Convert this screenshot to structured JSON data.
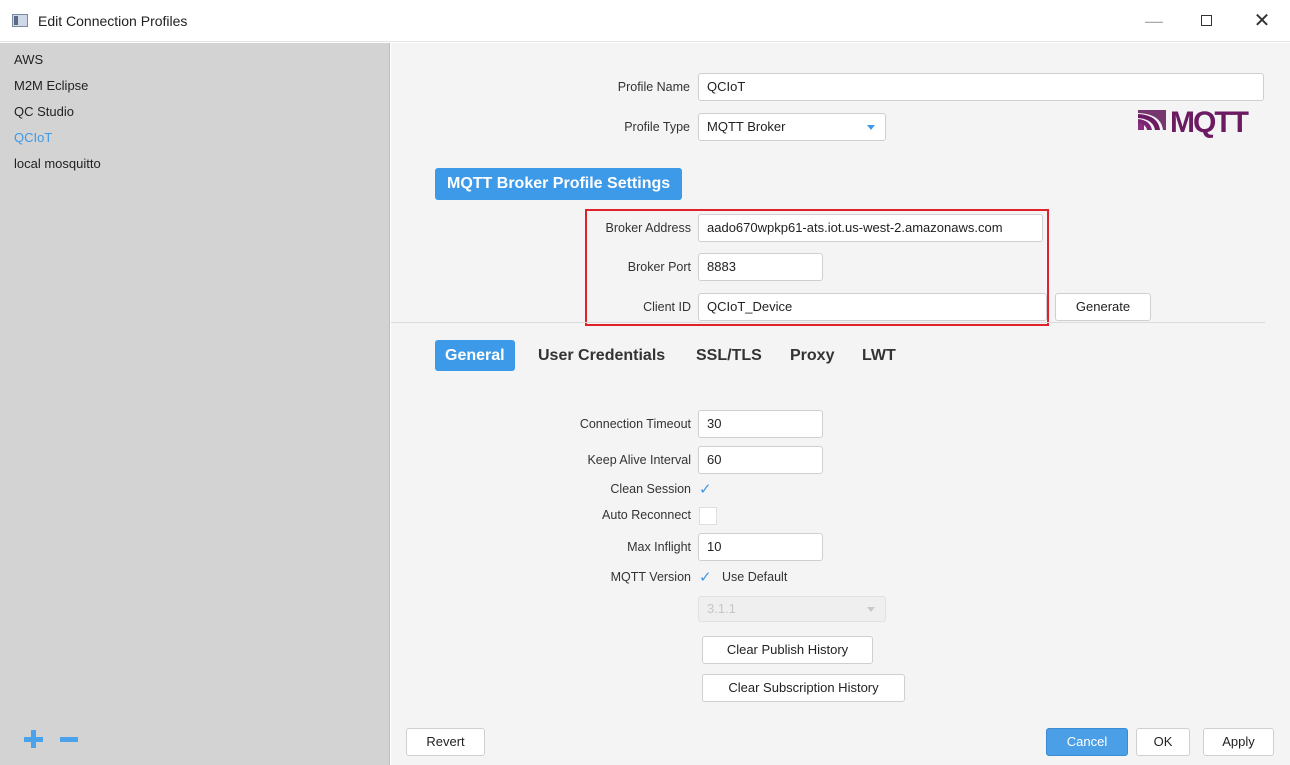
{
  "window": {
    "title": "Edit Connection Profiles",
    "minimize": "—",
    "maximize": "",
    "close": "✕"
  },
  "sidebar": {
    "profiles": [
      {
        "label": "AWS",
        "selected": false
      },
      {
        "label": "M2M Eclipse",
        "selected": false
      },
      {
        "label": "QC Studio",
        "selected": false
      },
      {
        "label": "QCIoT",
        "selected": true
      },
      {
        "label": "local mosquitto",
        "selected": false
      }
    ],
    "add_icon": "plus-icon",
    "remove_icon": "minus-icon"
  },
  "profile": {
    "name_label": "Profile Name",
    "name_value": "QCIoT",
    "type_label": "Profile Type",
    "type_value": "MQTT Broker",
    "logo_text": "MQTT"
  },
  "broker": {
    "section_title": "MQTT Broker Profile Settings",
    "address_label": "Broker Address",
    "address_value": "aado670wpkp61-ats.iot.us-west-2.amazonaws.com",
    "port_label": "Broker Port",
    "port_value": "8883",
    "client_id_label": "Client ID",
    "client_id_value": "QCIoT_Device",
    "generate_label": "Generate"
  },
  "tabs": [
    {
      "label": "General",
      "active": true
    },
    {
      "label": "User Credentials",
      "active": false
    },
    {
      "label": "SSL/TLS",
      "active": false
    },
    {
      "label": "Proxy",
      "active": false
    },
    {
      "label": "LWT",
      "active": false
    }
  ],
  "general": {
    "timeout_label": "Connection Timeout",
    "timeout_value": "30",
    "keepalive_label": "Keep Alive Interval",
    "keepalive_value": "60",
    "clean_session_label": "Clean Session",
    "clean_session_checked": true,
    "auto_reconnect_label": "Auto Reconnect",
    "auto_reconnect_checked": false,
    "max_inflight_label": "Max Inflight",
    "max_inflight_value": "10",
    "mqtt_version_label": "MQTT Version",
    "use_default_label": "Use Default",
    "use_default_checked": true,
    "version_value": "3.1.1",
    "clear_publish_label": "Clear Publish History",
    "clear_subscription_label": "Clear Subscription History"
  },
  "footer": {
    "revert_label": "Revert",
    "cancel_label": "Cancel",
    "ok_label": "OK",
    "apply_label": "Apply"
  },
  "colors": {
    "accent": "#3d9ae8",
    "highlight_box": "#e0202a",
    "mqtt_logo": "#6c1b63",
    "sidebar_bg": "#d3d3d3"
  }
}
